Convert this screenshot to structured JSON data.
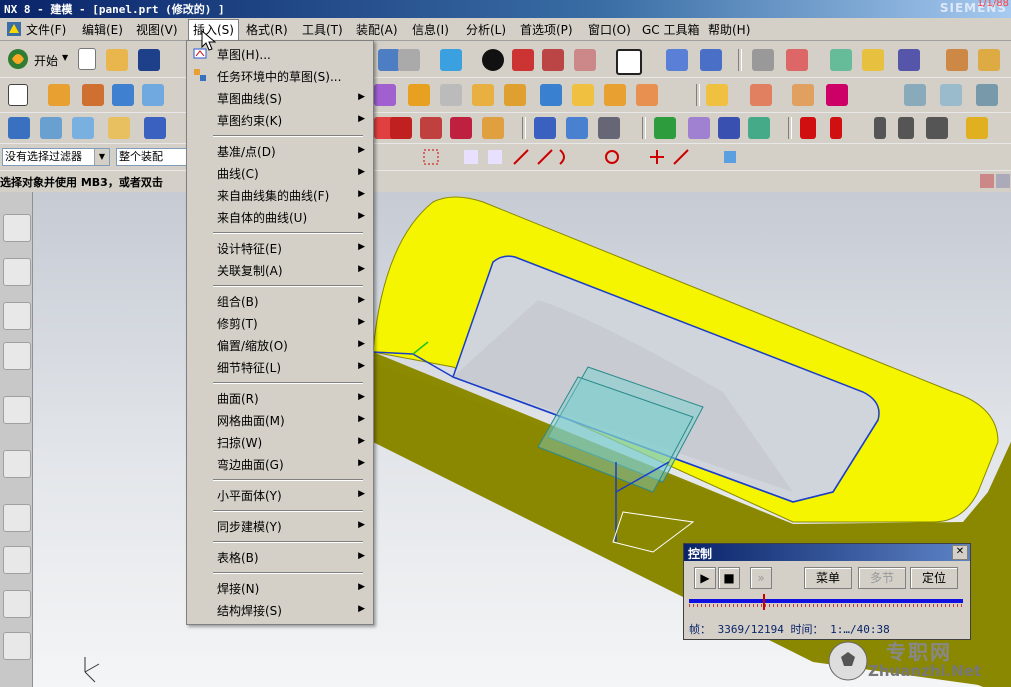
{
  "window": {
    "title": "NX 8 - 建模 - [panel.prt (修改的) ]",
    "brand": "SIEMENS",
    "brand_overlay": "1/1/88"
  },
  "menubar": {
    "items": [
      {
        "label": "文件(F)"
      },
      {
        "label": "编辑(E)"
      },
      {
        "label": "视图(V)"
      },
      {
        "label": "插入(S)"
      },
      {
        "label": "格式(R)"
      },
      {
        "label": "工具(T)"
      },
      {
        "label": "装配(A)"
      },
      {
        "label": "信息(I)"
      },
      {
        "label": "分析(L)"
      },
      {
        "label": "首选项(P)"
      },
      {
        "label": "窗口(O)"
      },
      {
        "label": "GC 工具箱"
      },
      {
        "label": "帮助(H)"
      }
    ],
    "active_index": 3
  },
  "toolbar": {
    "start_label": "开始"
  },
  "filter": {
    "selection_filter": "没有选择过滤器",
    "scope": "整个装配"
  },
  "status": {
    "prompt": "选择对象并使用 MB3，或者双击"
  },
  "insert_menu": {
    "groups": [
      [
        {
          "label": "草图(H)...",
          "has_sub": false,
          "icon": "sketch-icon"
        },
        {
          "label": "任务环境中的草图(S)...",
          "has_sub": false,
          "icon": "sketch-task-icon"
        },
        {
          "label": "草图曲线(S)",
          "has_sub": true
        },
        {
          "label": "草图约束(K)",
          "has_sub": true
        }
      ],
      [
        {
          "label": "基准/点(D)",
          "has_sub": true
        },
        {
          "label": "曲线(C)",
          "has_sub": true
        },
        {
          "label": "来自曲线集的曲线(F)",
          "has_sub": true
        },
        {
          "label": "来自体的曲线(U)",
          "has_sub": true
        }
      ],
      [
        {
          "label": "设计特征(E)",
          "has_sub": true
        },
        {
          "label": "关联复制(A)",
          "has_sub": true
        }
      ],
      [
        {
          "label": "组合(B)",
          "has_sub": true
        },
        {
          "label": "修剪(T)",
          "has_sub": true
        },
        {
          "label": "偏置/缩放(O)",
          "has_sub": true
        },
        {
          "label": "细节特征(L)",
          "has_sub": true
        }
      ],
      [
        {
          "label": "曲面(R)",
          "has_sub": true
        },
        {
          "label": "网格曲面(M)",
          "has_sub": true
        },
        {
          "label": "扫掠(W)",
          "has_sub": true
        },
        {
          "label": "弯边曲面(G)",
          "has_sub": true
        }
      ],
      [
        {
          "label": "小平面体(Y)",
          "has_sub": true
        }
      ],
      [
        {
          "label": "同步建模(Y)",
          "has_sub": true
        }
      ],
      [
        {
          "label": "表格(B)",
          "has_sub": true
        }
      ],
      [
        {
          "label": "焊接(N)",
          "has_sub": true
        },
        {
          "label": "结构焊接(S)",
          "has_sub": true
        }
      ]
    ]
  },
  "control_dialog": {
    "title": "控制",
    "menu_label": "菜单",
    "multi_label": "多节",
    "position_label": "定位",
    "frame_label": "帧：",
    "frame_value": "3369/12194",
    "time_label": "时间：",
    "time_value": "1:…/40:38",
    "progress": 0.27
  },
  "watermark": {
    "site_cn": "专职网",
    "site_url": "Zhuanzhi.Net"
  },
  "colors": {
    "part_yellow": "#f5f500",
    "part_side": "#8c8a00",
    "edge_blue": "#1a3ec8",
    "plane_teal": "#7fcfcf"
  }
}
